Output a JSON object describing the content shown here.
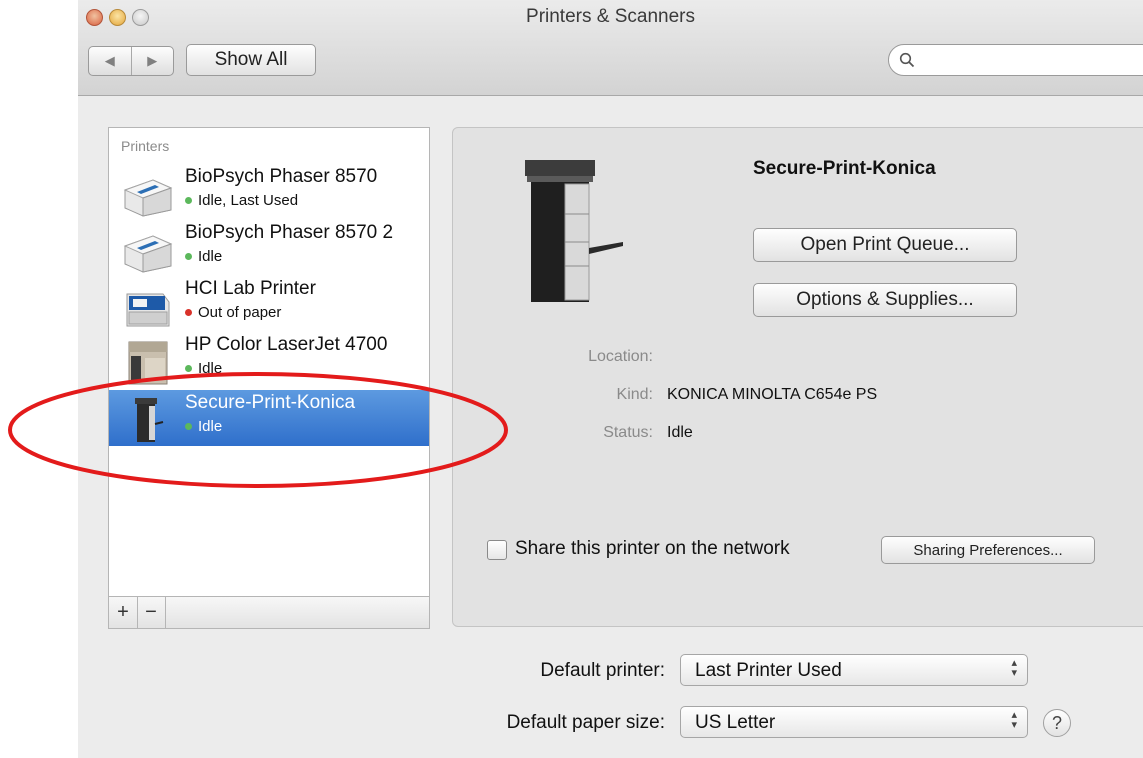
{
  "window": {
    "title": "Printers & Scanners"
  },
  "toolbar": {
    "back_label": "◀",
    "forward_label": "▶",
    "show_all_label": "Show All",
    "search_placeholder": "",
    "search_value": ""
  },
  "printers": {
    "header": "Printers",
    "items": [
      {
        "name": "BioPsych Phaser 8570",
        "status": "Idle, Last Used",
        "status_color": "#5cb85c",
        "icon": "laser-printer-icon"
      },
      {
        "name": "BioPsych Phaser 8570 2",
        "status": "Idle",
        "status_color": "#5cb85c",
        "icon": "laser-printer-icon"
      },
      {
        "name": "HCI Lab Printer",
        "status": "Out of paper",
        "status_color": "#d9322a",
        "icon": "color-printer-icon"
      },
      {
        "name": "HP Color LaserJet 4700",
        "status": "Idle",
        "status_color": "#5cb85c",
        "icon": "hp-printer-icon"
      },
      {
        "name": "Secure-Print-Konica",
        "status": "Idle",
        "status_color": "#5cb85c",
        "icon": "copier-icon",
        "selected": true
      }
    ],
    "add_label": "+",
    "remove_label": "−"
  },
  "detail": {
    "name": "Secure-Print-Konica",
    "open_queue_label": "Open Print Queue...",
    "options_label": "Options & Supplies...",
    "location_label": "Location:",
    "location_value": "",
    "kind_label": "Kind:",
    "kind_value": "KONICA MINOLTA C654e PS",
    "status_label": "Status:",
    "status_value": "Idle",
    "share_label": "Share this printer on the network",
    "share_checked": false,
    "sharing_prefs_label": "Sharing Preferences..."
  },
  "defaults": {
    "printer_label": "Default printer:",
    "printer_value": "Last Printer Used",
    "paper_label": "Default paper size:",
    "paper_value": "US Letter",
    "help_label": "?"
  },
  "colors": {
    "selection": "#3a7bd5",
    "highlight_oval": "#e31b1b"
  }
}
